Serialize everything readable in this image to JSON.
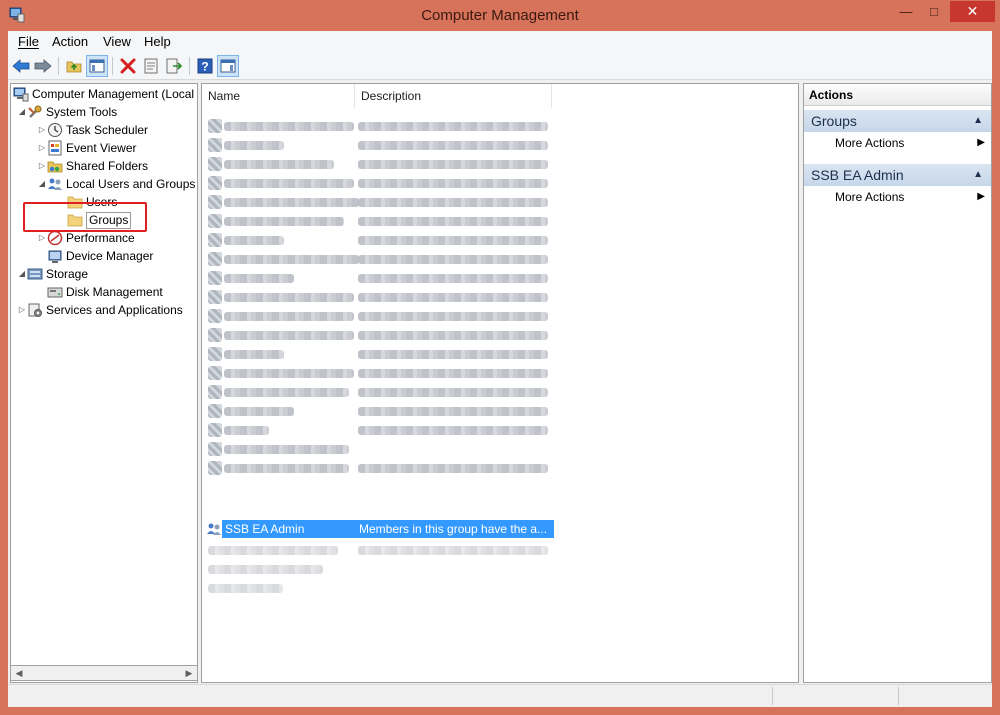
{
  "window": {
    "title": "Computer Management"
  },
  "menu": {
    "items": [
      {
        "label": "File",
        "mnemonic": "F"
      },
      {
        "label": "Action",
        "mnemonic": "A"
      },
      {
        "label": "View",
        "mnemonic": "V"
      },
      {
        "label": "Help",
        "mnemonic": "H"
      }
    ]
  },
  "toolbar": {
    "buttons": [
      "back-icon",
      "forward-icon",
      "up-folder-icon",
      "show-hide-tree-icon",
      "delete-icon",
      "properties-icon",
      "export-list-icon",
      "help-icon",
      "show-hide-action-pane-icon"
    ]
  },
  "tree": {
    "root": "Computer Management (Local",
    "system_tools": "System Tools",
    "task_scheduler": "Task Scheduler",
    "event_viewer": "Event Viewer",
    "shared_folders": "Shared Folders",
    "local_users_groups": "Local Users and Groups",
    "users": "Users",
    "groups": "Groups",
    "performance": "Performance",
    "device_manager": "Device Manager",
    "storage": "Storage",
    "disk_management": "Disk Management",
    "services_apps": "Services and Applications"
  },
  "list": {
    "col_name": "Name",
    "col_description": "Description",
    "selected_name": "SSB EA Admin",
    "selected_description": "Members in this group have the a..."
  },
  "actions": {
    "title": "Actions",
    "sections": [
      {
        "title": "Groups",
        "link": "More Actions"
      },
      {
        "title": "SSB EA Admin",
        "link": "More Actions"
      }
    ]
  },
  "colors": {
    "window_frame": "#d8735b",
    "selection": "#3399ff",
    "close_button": "#c7372f",
    "highlight_box": "#e02020"
  }
}
